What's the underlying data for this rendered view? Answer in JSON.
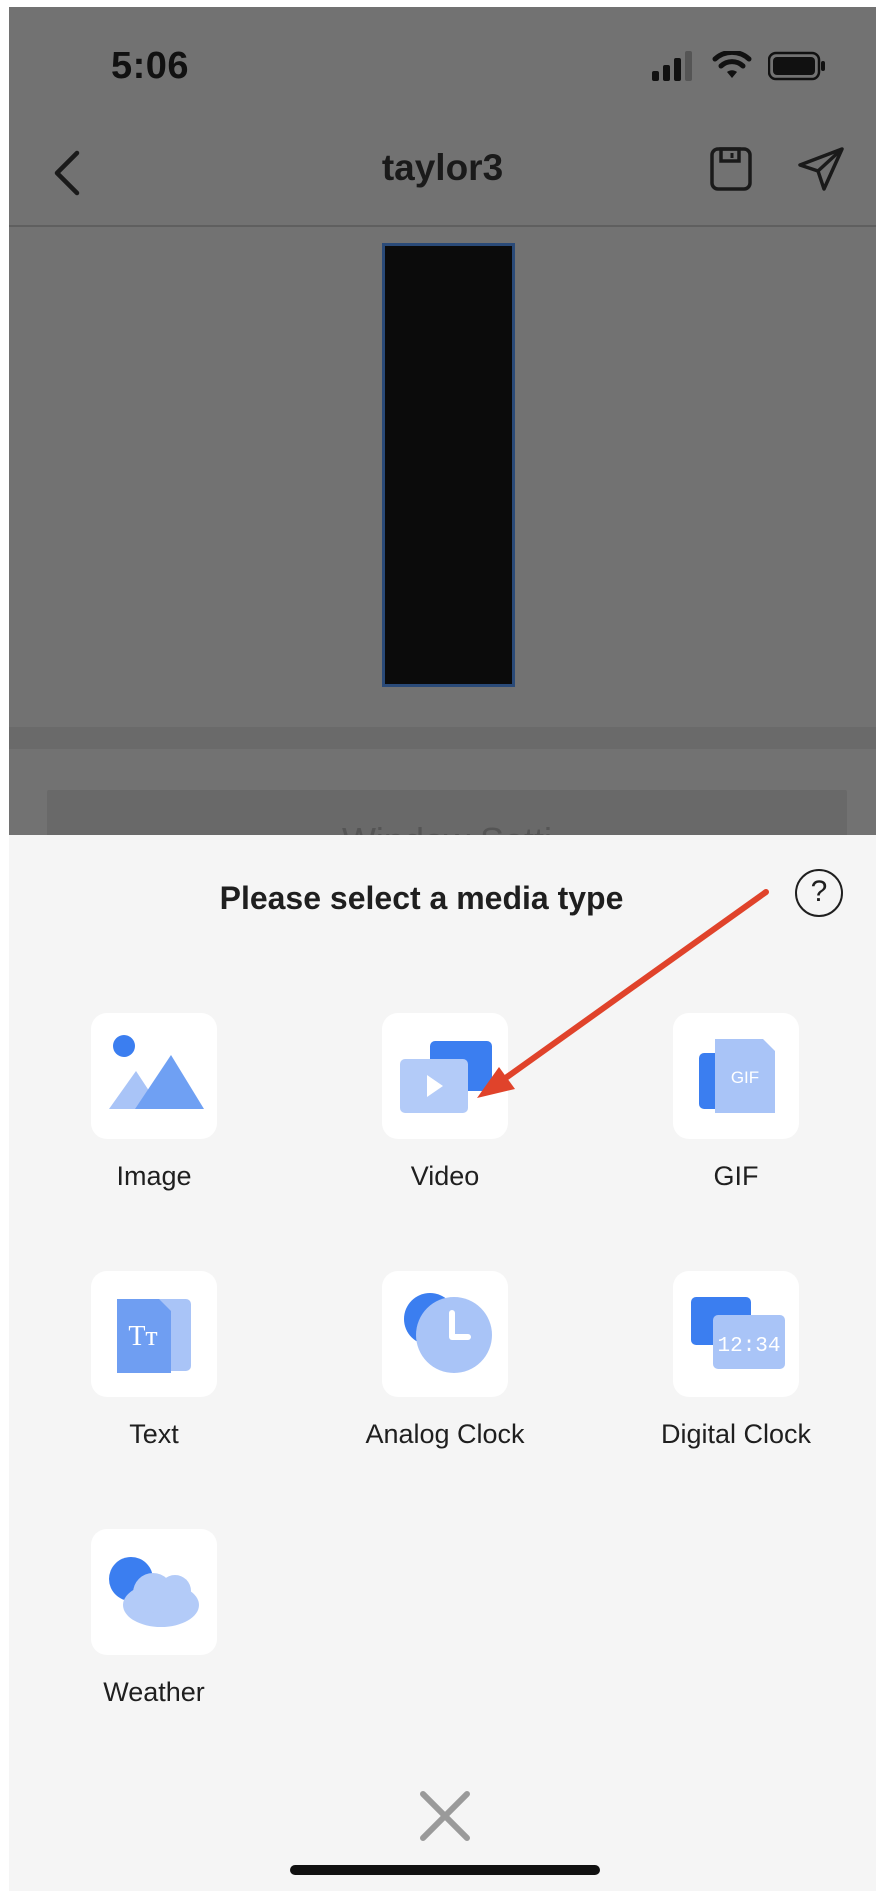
{
  "status_bar": {
    "time": "5:06"
  },
  "navbar": {
    "title": "taylor3"
  },
  "behind": {
    "window_settings_label": "Window Setti"
  },
  "sheet": {
    "title": "Please select a media type",
    "help_symbol": "?",
    "media_types": [
      {
        "label": "Image",
        "icon": "image-icon"
      },
      {
        "label": "Video",
        "icon": "video-icon"
      },
      {
        "label": "GIF",
        "icon": "gif-icon",
        "badge": "GIF"
      },
      {
        "label": "Text",
        "icon": "text-icon",
        "glyph": "Tт"
      },
      {
        "label": "Analog Clock",
        "icon": "analog-clock-icon"
      },
      {
        "label": "Digital Clock",
        "icon": "digital-clock-icon",
        "display": "12:34"
      },
      {
        "label": "Weather",
        "icon": "weather-icon"
      }
    ]
  },
  "colors": {
    "accent_blue": "#3b7ef0",
    "light_blue": "#a9c4f7",
    "annotation_arrow": "#e0432b",
    "dim_overlay": "#727272"
  }
}
